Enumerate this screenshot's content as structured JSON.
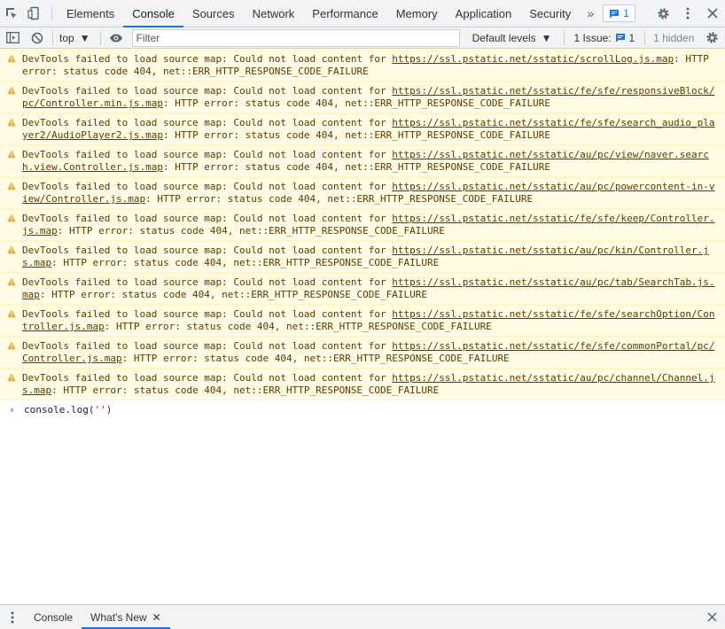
{
  "tabs": {
    "items": [
      {
        "label": "Elements"
      },
      {
        "label": "Console"
      },
      {
        "label": "Sources"
      },
      {
        "label": "Network"
      },
      {
        "label": "Performance"
      },
      {
        "label": "Memory"
      },
      {
        "label": "Application"
      },
      {
        "label": "Security"
      }
    ],
    "active": "Console",
    "message_count": "1"
  },
  "toolbar": {
    "context": "top",
    "filter_placeholder": "Filter",
    "levels": "Default levels",
    "issues_label": "1 Issue:",
    "issues_count": "1",
    "hidden": "1 hidden"
  },
  "messages": [
    {
      "prefix": "DevTools failed to load source map: Could not load content for ",
      "url": "https://ssl.pstatic.net/sstatic/scrollLog.js.map",
      "suffix": ": HTTP error: status code 404, net::ERR_HTTP_RESPONSE_CODE_FAILURE"
    },
    {
      "prefix": "DevTools failed to load source map: Could not load content for ",
      "url": "https://ssl.pstatic.net/sstatic/fe/sfe/responsiveBlock/pc/Controller.min.js.map",
      "suffix": ": HTTP error: status code 404, net::ERR_HTTP_RESPONSE_CODE_FAILURE"
    },
    {
      "prefix": "DevTools failed to load source map: Could not load content for ",
      "url": "https://ssl.pstatic.net/sstatic/fe/sfe/search_audio_player2/AudioPlayer2.js.map",
      "suffix": ": HTTP error: status code 404, net::ERR_HTTP_RESPONSE_CODE_FAILURE"
    },
    {
      "prefix": "DevTools failed to load source map: Could not load content for ",
      "url": "https://ssl.pstatic.net/sstatic/au/pc/view/naver.search.view.Controller.js.map",
      "suffix": ": HTTP error: status code 404, net::ERR_HTTP_RESPONSE_CODE_FAILURE"
    },
    {
      "prefix": "DevTools failed to load source map: Could not load content for ",
      "url": "https://ssl.pstatic.net/sstatic/au/pc/powercontent-in-view/Controller.js.map",
      "suffix": ": HTTP error: status code 404, net::ERR_HTTP_RESPONSE_CODE_FAILURE"
    },
    {
      "prefix": "DevTools failed to load source map: Could not load content for ",
      "url": "https://ssl.pstatic.net/sstatic/fe/sfe/keep/Controller.js.map",
      "suffix": ": HTTP error: status code 404, net::ERR_HTTP_RESPONSE_CODE_FAILURE"
    },
    {
      "prefix": "DevTools failed to load source map: Could not load content for ",
      "url": "https://ssl.pstatic.net/sstatic/au/pc/kin/Controller.js.map",
      "suffix": ": HTTP error: status code 404, net::ERR_HTTP_RESPONSE_CODE_FAILURE"
    },
    {
      "prefix": "DevTools failed to load source map: Could not load content for ",
      "url": "https://ssl.pstatic.net/sstatic/au/pc/tab/SearchTab.js.map",
      "suffix": ": HTTP error: status code 404, net::ERR_HTTP_RESPONSE_CODE_FAILURE"
    },
    {
      "prefix": "DevTools failed to load source map: Could not load content for ",
      "url": "https://ssl.pstatic.net/sstatic/fe/sfe/searchOption/Controller.js.map",
      "suffix": ": HTTP error: status code 404, net::ERR_HTTP_RESPONSE_CODE_FAILURE"
    },
    {
      "prefix": "DevTools failed to load source map: Could not load content for ",
      "url": "https://ssl.pstatic.net/sstatic/fe/sfe/commonPortal/pc/Controller.js.map",
      "suffix": ": HTTP error: status code 404, net::ERR_HTTP_RESPONSE_CODE_FAILURE"
    },
    {
      "prefix": "DevTools failed to load source map: Could not load content for ",
      "url": "https://ssl.pstatic.net/sstatic/au/pc/channel/Channel.js.map",
      "suffix": ": HTTP error: status code 404, net::ERR_HTTP_RESPONSE_CODE_FAILURE"
    }
  ],
  "prompt": {
    "code_before": "console.log(",
    "code_string": "''",
    "code_after": ")"
  },
  "drawer": {
    "tabs": [
      {
        "label": "Console"
      },
      {
        "label": "What's New"
      }
    ],
    "active": "What's New"
  }
}
